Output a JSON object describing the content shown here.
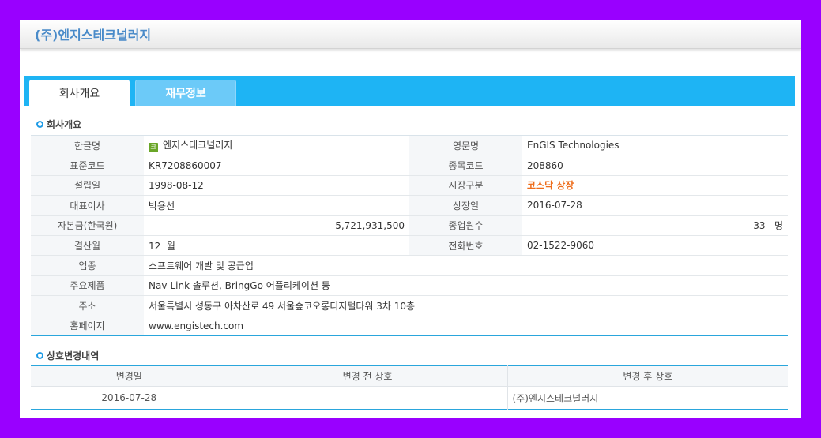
{
  "page": {
    "title": "(주)엔지스테크널러지"
  },
  "tabs": [
    {
      "label": "회사개요",
      "active": true
    },
    {
      "label": "재무정보",
      "active": false
    }
  ],
  "sections": {
    "overview": "회사개요",
    "history": "상호변경내역"
  },
  "overview": {
    "rows": [
      {
        "label": "한글명",
        "value": "엔지스테크널러지",
        "label2": "영문명",
        "value2": "EnGIS Technologies"
      },
      {
        "label": "표준코드",
        "value": "KR7208860007",
        "label2": "종목코드",
        "value2": "208860"
      },
      {
        "label": "설립일",
        "value": "1998-08-12",
        "label2": "시장구분",
        "value2": "코스닥 상장"
      },
      {
        "label": "대표이사",
        "value": "박용선",
        "label2": "상장일",
        "value2": "2016-07-28"
      },
      {
        "label": "자본금(한국원)",
        "value": "5,721,931,500",
        "label2": "종업원수",
        "value2": "33",
        "unit2": "명"
      },
      {
        "label": "결산월",
        "value": "12",
        "unit": "월",
        "label2": "전화번호",
        "value2": "02-1522-9060"
      },
      {
        "label": "업종",
        "value": "소프트웨어 개발 및 공급업"
      },
      {
        "label": "주요제품",
        "value": "Nav-Link 솔루션, BringGo 어플리케이션 등"
      },
      {
        "label": "주소",
        "value": "서울특별시 성동구 아차산로 49 서울숲코오롱디지털타워 3차 10층"
      },
      {
        "label": "홈페이지",
        "value": "www.engistech.com"
      }
    ],
    "market_icon": {
      "name": "kosdaq-icon",
      "glyph": "코",
      "color": "#6aa628"
    },
    "accent_color": "#ee6c1a"
  },
  "history": {
    "headers": [
      "변경일",
      "변경 전 상호",
      "변경 후 상호"
    ],
    "rows": [
      {
        "date": "2016-07-28",
        "before": "",
        "after": "(주)엔지스테크널러지"
      }
    ]
  },
  "colors": {
    "tab_strip": "#1eb4f4",
    "title_text": "#4a8bc9",
    "background": "#9900ff"
  }
}
